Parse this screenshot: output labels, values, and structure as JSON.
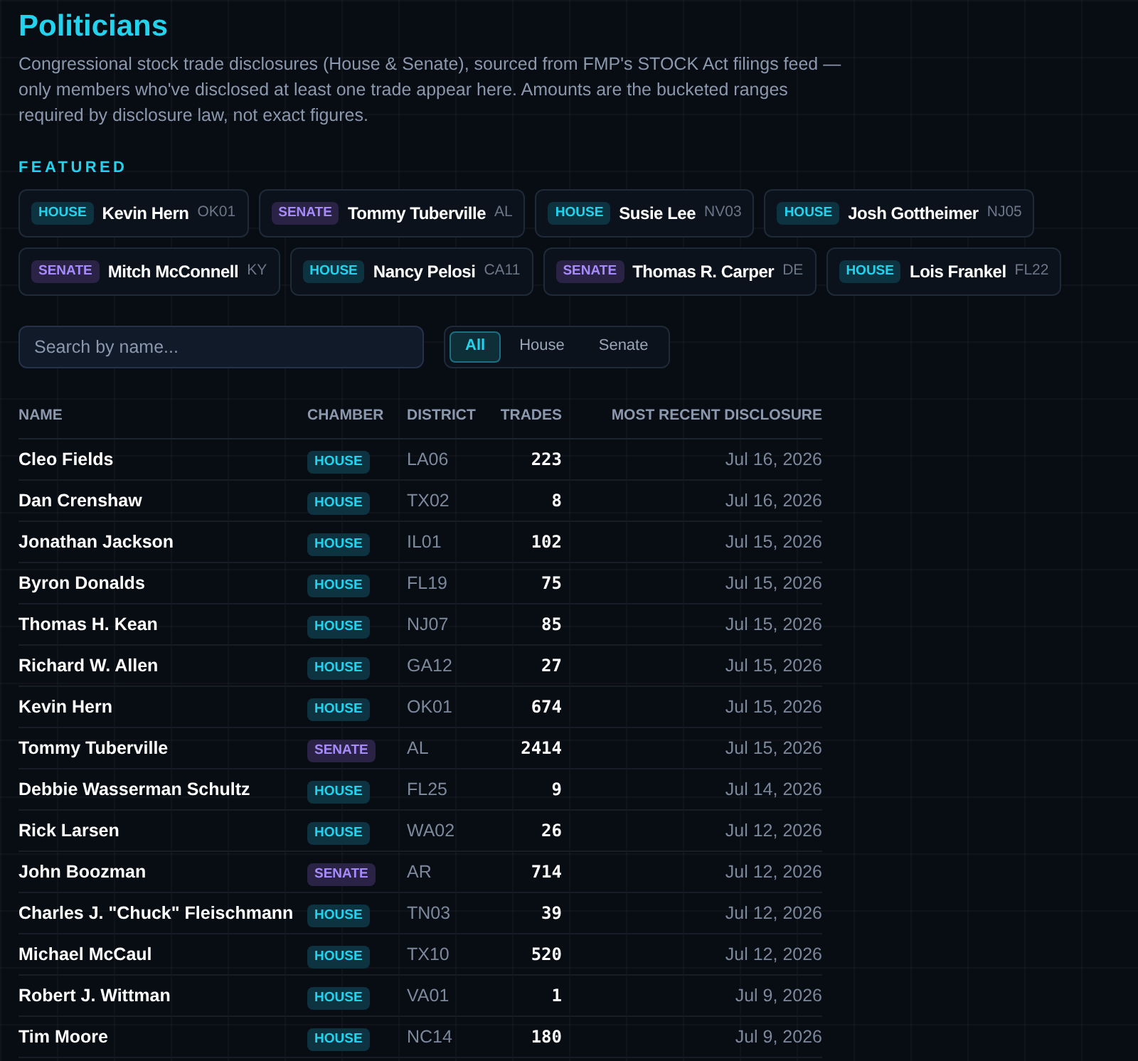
{
  "title": "Politicians",
  "description": "Congressional stock trade disclosures (House & Senate), sourced from FMP's STOCK Act filings feed — only members who've disclosed at least one trade appear here. Amounts are the bucketed ranges required by disclosure law, not exact figures.",
  "featured": {
    "label": "FEATURED",
    "items": [
      {
        "chamber": "HOUSE",
        "kind": "house",
        "name": "Kevin Hern",
        "district": "OK01"
      },
      {
        "chamber": "SENATE",
        "kind": "senate",
        "name": "Tommy Tuberville",
        "district": "AL"
      },
      {
        "chamber": "HOUSE",
        "kind": "house",
        "name": "Susie Lee",
        "district": "NV03"
      },
      {
        "chamber": "HOUSE",
        "kind": "house",
        "name": "Josh Gottheimer",
        "district": "NJ05"
      },
      {
        "chamber": "SENATE",
        "kind": "senate",
        "name": "Mitch McConnell",
        "district": "KY"
      },
      {
        "chamber": "HOUSE",
        "kind": "house",
        "name": "Nancy Pelosi",
        "district": "CA11"
      },
      {
        "chamber": "SENATE",
        "kind": "senate",
        "name": "Thomas R. Carper",
        "district": "DE"
      },
      {
        "chamber": "HOUSE",
        "kind": "house",
        "name": "Lois Frankel",
        "district": "FL22"
      }
    ]
  },
  "search": {
    "placeholder": "Search by name..."
  },
  "filters": [
    {
      "label": "All",
      "selected": true
    },
    {
      "label": "House",
      "selected": false
    },
    {
      "label": "Senate",
      "selected": false
    }
  ],
  "table": {
    "columns": [
      "NAME",
      "CHAMBER",
      "DISTRICT",
      "TRADES",
      "MOST RECENT DISCLOSURE"
    ],
    "rows": [
      {
        "name": "Cleo Fields",
        "chamber": "HOUSE",
        "kind": "house",
        "district": "LA06",
        "trades": "223",
        "date": "Jul 16, 2026"
      },
      {
        "name": "Dan Crenshaw",
        "chamber": "HOUSE",
        "kind": "house",
        "district": "TX02",
        "trades": "8",
        "date": "Jul 16, 2026"
      },
      {
        "name": "Jonathan Jackson",
        "chamber": "HOUSE",
        "kind": "house",
        "district": "IL01",
        "trades": "102",
        "date": "Jul 15, 2026"
      },
      {
        "name": "Byron Donalds",
        "chamber": "HOUSE",
        "kind": "house",
        "district": "FL19",
        "trades": "75",
        "date": "Jul 15, 2026"
      },
      {
        "name": "Thomas H. Kean",
        "chamber": "HOUSE",
        "kind": "house",
        "district": "NJ07",
        "trades": "85",
        "date": "Jul 15, 2026"
      },
      {
        "name": "Richard W. Allen",
        "chamber": "HOUSE",
        "kind": "house",
        "district": "GA12",
        "trades": "27",
        "date": "Jul 15, 2026"
      },
      {
        "name": "Kevin Hern",
        "chamber": "HOUSE",
        "kind": "house",
        "district": "OK01",
        "trades": "674",
        "date": "Jul 15, 2026"
      },
      {
        "name": "Tommy Tuberville",
        "chamber": "SENATE",
        "kind": "senate",
        "district": "AL",
        "trades": "2414",
        "date": "Jul 15, 2026"
      },
      {
        "name": "Debbie Wasserman Schultz",
        "chamber": "HOUSE",
        "kind": "house",
        "district": "FL25",
        "trades": "9",
        "date": "Jul 14, 2026"
      },
      {
        "name": "Rick Larsen",
        "chamber": "HOUSE",
        "kind": "house",
        "district": "WA02",
        "trades": "26",
        "date": "Jul 12, 2026"
      },
      {
        "name": "John Boozman",
        "chamber": "SENATE",
        "kind": "senate",
        "district": "AR",
        "trades": "714",
        "date": "Jul 12, 2026"
      },
      {
        "name": "Charles J. \"Chuck\" Fleischmann",
        "chamber": "HOUSE",
        "kind": "house",
        "district": "TN03",
        "trades": "39",
        "date": "Jul 12, 2026"
      },
      {
        "name": "Michael McCaul",
        "chamber": "HOUSE",
        "kind": "house",
        "district": "TX10",
        "trades": "520",
        "date": "Jul 12, 2026"
      },
      {
        "name": "Robert J. Wittman",
        "chamber": "HOUSE",
        "kind": "house",
        "district": "VA01",
        "trades": "1",
        "date": "Jul 9, 2026"
      },
      {
        "name": "Tim Moore",
        "chamber": "HOUSE",
        "kind": "house",
        "district": "NC14",
        "trades": "180",
        "date": "Jul 9, 2026"
      }
    ]
  }
}
